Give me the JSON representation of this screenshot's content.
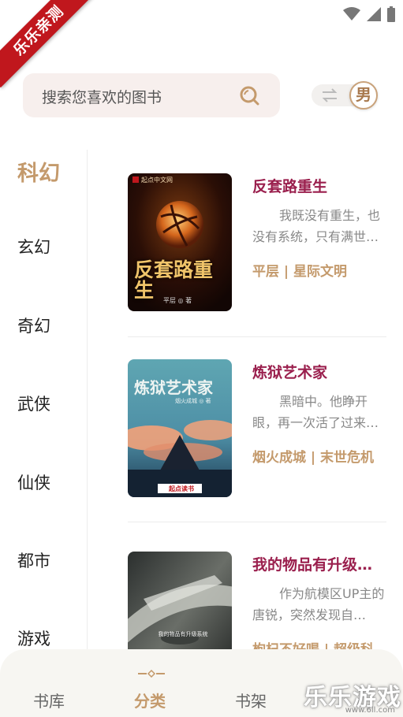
{
  "watermark_corner": "乐乐亲测",
  "search": {
    "placeholder": "搜索您喜欢的图书"
  },
  "gender_toggle": {
    "label": "男"
  },
  "sidebar": {
    "items": [
      {
        "label": "科幻",
        "active": true
      },
      {
        "label": "玄幻"
      },
      {
        "label": "奇幻"
      },
      {
        "label": "武侠"
      },
      {
        "label": "仙侠"
      },
      {
        "label": "都市"
      },
      {
        "label": "游戏"
      }
    ]
  },
  "books": [
    {
      "title": "反套路重生",
      "desc": "我既没有重生，也没有系统，只有满世…",
      "tags": "平层 | 星际文明",
      "cover_text": "反套路重生",
      "cover_author": "平层 ◎ 著",
      "cover_badge": "起点中文网"
    },
    {
      "title": "炼狱艺术家",
      "desc": "黑暗中。他睁开眼，再一次活了过来…",
      "tags": "烟火成城 | 末世危机",
      "cover_text": "炼狱艺术家",
      "cover_author": "烟火成城 ◎ 著",
      "cover_badge": "起点读书"
    },
    {
      "title": "我的物品有升级…",
      "desc": "作为航模区UP主的唐锐，突然发现自…",
      "tags": "枸杞不好喝 | 超级科",
      "cover_text": "我的物品有升级系统",
      "cover_author": "",
      "cover_badge": ""
    }
  ],
  "bottom_nav": {
    "items": [
      {
        "label": "书库"
      },
      {
        "label": "分类",
        "active": true
      },
      {
        "label": "书架"
      }
    ]
  },
  "watermark_bottom": {
    "main": "乐乐游戏",
    "sub": "www.6ll.com"
  },
  "colors": {
    "accent": "#c49a6c",
    "title": "#9a1f4d",
    "ribbon": "#c0171d"
  }
}
